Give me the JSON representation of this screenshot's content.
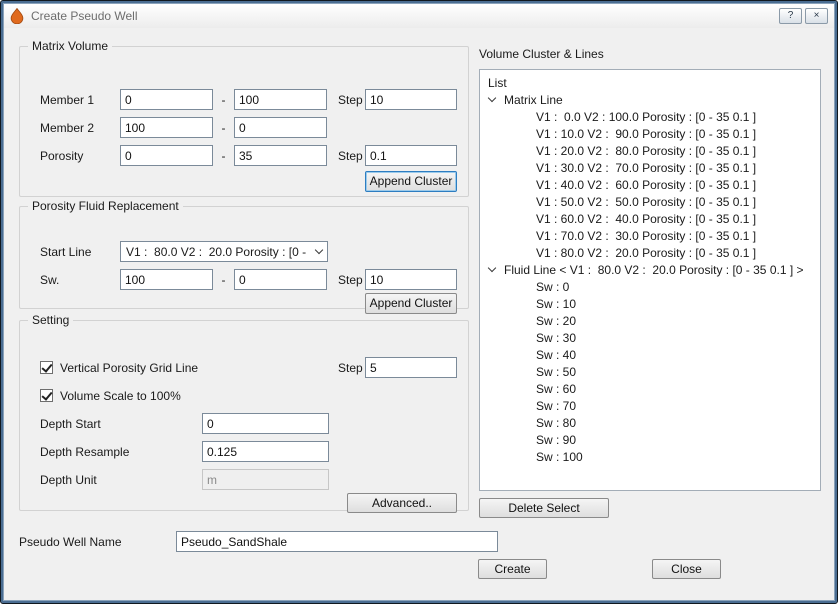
{
  "window": {
    "title": "Create Pseudo Well"
  },
  "titlebar": {
    "help_label": "?",
    "close_label": "×"
  },
  "labels": {
    "dash": "-",
    "step": "Step"
  },
  "matrix_volume": {
    "title": "Matrix Volume",
    "member1_label": "Member 1",
    "member1_from": "0",
    "member1_to": "100",
    "member1_step": "10",
    "member2_label": "Member 2",
    "member2_from": "100",
    "member2_to": "0",
    "porosity_label": "Porosity",
    "porosity_from": "0",
    "porosity_to": "35",
    "porosity_step": "0.1",
    "append_button": "Append Cluster"
  },
  "fluid_replacement": {
    "title": "Porosity Fluid Replacement",
    "start_line_label": "Start Line",
    "start_line_value": "V1 :  80.0 V2 :  20.0 Porosity : [0 -",
    "sw_label": "Sw.",
    "sw_from": "100",
    "sw_to": "0",
    "sw_step": "10",
    "append_button": "Append Cluster"
  },
  "setting": {
    "title": "Setting",
    "vertical_grid_label": "Vertical Porosity Grid Line",
    "vertical_grid_checked": true,
    "vertical_grid_step": "5",
    "volume_scale_label": "Volume Scale to 100%",
    "volume_scale_checked": true,
    "depth_start_label": "Depth Start",
    "depth_start_value": "0",
    "depth_resample_label": "Depth Resample",
    "depth_resample_value": "0.125",
    "depth_unit_label": "Depth Unit",
    "depth_unit_value": "m",
    "advanced_button": "Advanced.."
  },
  "pseudo_well": {
    "label": "Pseudo Well Name",
    "value": "Pseudo_SandShale"
  },
  "cluster_panel": {
    "title": "Volume Cluster & Lines",
    "list_header": "List",
    "matrix_line_label": "Matrix Line",
    "matrix_items": [
      "V1 :  0.0 V2 : 100.0 Porosity : [0 - 35 0.1 ]",
      "V1 : 10.0 V2 :  90.0 Porosity : [0 - 35 0.1 ]",
      "V1 : 20.0 V2 :  80.0 Porosity : [0 - 35 0.1 ]",
      "V1 : 30.0 V2 :  70.0 Porosity : [0 - 35 0.1 ]",
      "V1 : 40.0 V2 :  60.0 Porosity : [0 - 35 0.1 ]",
      "V1 : 50.0 V2 :  50.0 Porosity : [0 - 35 0.1 ]",
      "V1 : 60.0 V2 :  40.0 Porosity : [0 - 35 0.1 ]",
      "V1 : 70.0 V2 :  30.0 Porosity : [0 - 35 0.1 ]",
      "V1 : 80.0 V2 :  20.0 Porosity : [0 - 35 0.1 ]"
    ],
    "fluid_line_label": "Fluid Line < V1 :  80.0 V2 :  20.0 Porosity : [0 - 35 0.1 ] >",
    "fluid_items": [
      "Sw : 0",
      "Sw : 10",
      "Sw : 20",
      "Sw : 30",
      "Sw : 40",
      "Sw : 50",
      "Sw : 60",
      "Sw : 70",
      "Sw : 80",
      "Sw : 90",
      "Sw : 100"
    ],
    "delete_button": "Delete Select"
  },
  "footer": {
    "create_button": "Create",
    "close_button": "Close"
  },
  "colors": {
    "accent_blue": "#2d7dc1",
    "window_border": "#4a6d92",
    "titlebar_text": "#6d6d6d",
    "icon_orange": "#e06a1e"
  }
}
